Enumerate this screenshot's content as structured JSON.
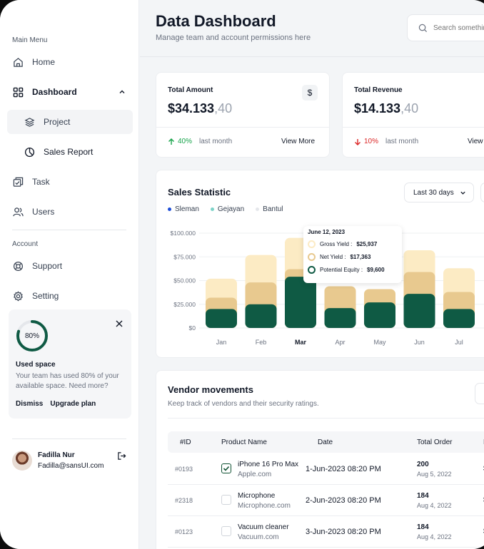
{
  "sidebar": {
    "main_menu_label": "Main Menu",
    "items": [
      {
        "label": "Home",
        "icon": "home-icon"
      },
      {
        "label": "Dashboard",
        "icon": "grid-icon"
      },
      {
        "label": "Project",
        "icon": "layers-icon"
      },
      {
        "label": "Sales Report",
        "icon": "pie-chart-icon"
      },
      {
        "label": "Task",
        "icon": "task-icon"
      },
      {
        "label": "Users",
        "icon": "users-icon"
      }
    ],
    "account_label": "Account",
    "account_items": [
      {
        "label": "Support",
        "icon": "lifebuoy-icon"
      },
      {
        "label": "Setting",
        "icon": "gear-icon"
      }
    ],
    "space": {
      "percent_label": "80%",
      "percent": 80,
      "title": "Used space",
      "description": "Your team has used 80% of your available space. Need more?",
      "dismiss": "Dismiss",
      "upgrade": "Upgrade plan"
    },
    "user": {
      "name": "Fadilla Nur",
      "email": "Fadilla@sansUI.com"
    }
  },
  "header": {
    "title": "Data Dashboard",
    "subtitle": "Manage team and account permissions here",
    "search_placeholder": "Search something"
  },
  "stats": [
    {
      "title": "Total Amount",
      "value": "$34.133",
      "decimal": ",40",
      "change": "40%",
      "direction": "up",
      "period": "last month",
      "more": "View More"
    },
    {
      "title": "Total Revenue",
      "value": "$14.133",
      "decimal": ",40",
      "change": "10%",
      "direction": "down",
      "period": "last month",
      "more": "View More"
    }
  ],
  "sales": {
    "title": "Sales Statistic",
    "range": "Last 30 days",
    "legend": [
      "Sleman",
      "Gejayan",
      "Bantul"
    ],
    "legend_colors": [
      "#1d4ed8",
      "#7dd3c8",
      "#e5e7eb"
    ],
    "tooltip": {
      "date": "June 12, 2023",
      "rows": [
        {
          "label": "Gross Yield :",
          "value": "$25,937"
        },
        {
          "label": "Net Yield :",
          "value": "$17,363"
        },
        {
          "label": "Potential Equity :",
          "value": "$9,600"
        }
      ]
    }
  },
  "chart_data": {
    "type": "bar",
    "categories": [
      "Jan",
      "Feb",
      "Mar",
      "Apr",
      "May",
      "Jun",
      "Jul"
    ],
    "highlight": "Mar",
    "ylim": [
      0,
      100000
    ],
    "yticks": [
      "$0",
      "$25.000",
      "$50.000",
      "$75.000",
      "$100.000"
    ],
    "series": [
      {
        "values": [
          52000,
          77000,
          95000,
          44000,
          41000,
          82000,
          63000
        ],
        "color": "#fcebc4"
      },
      {
        "values": [
          32000,
          48000,
          62000,
          44000,
          41000,
          59000,
          38000
        ],
        "color": "#e8c98f"
      },
      {
        "values": [
          20000,
          25000,
          54000,
          21000,
          27000,
          36000,
          20000
        ],
        "color": "#0f5a44"
      }
    ]
  },
  "vendors": {
    "title": "Vendor movements",
    "subtitle": "Keep track of vendors and their security ratings.",
    "columns": [
      "#ID",
      "Product Name",
      "Date",
      "Total Order",
      "P"
    ],
    "rows": [
      {
        "id": "#0193",
        "product": "iPhone 16 Pro Max",
        "brand": "Apple.com",
        "date": "1-Jun-2023 08:20 PM",
        "total": "200",
        "total_date": "Aug 5, 2022",
        "cut": "$",
        "checked": true
      },
      {
        "id": "#2318",
        "product": "Microphone",
        "brand": "Microphone.com",
        "date": "2-Jun-2023 08:20 PM",
        "total": "184",
        "total_date": "Aug 4, 2022",
        "cut": "$",
        "checked": false
      },
      {
        "id": "#0123",
        "product": "Vacuum cleaner",
        "brand": "Vacuum.com",
        "date": "3-Jun-2023 08:20 PM",
        "total": "184",
        "total_date": "Aug 4, 2022",
        "cut": "$",
        "checked": false
      }
    ]
  }
}
